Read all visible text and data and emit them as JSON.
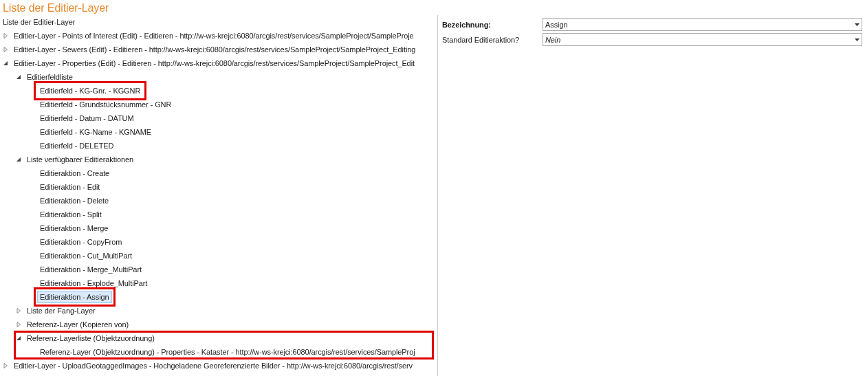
{
  "title": "Liste der Editier-Layer",
  "tree": {
    "label": "Liste der Editier-Layer",
    "nodes": [
      {
        "kind": "branch",
        "label": "Editier-Layer - Points of Interest (Edit) - Editieren - http://w-ws-krejci:6080/arcgis/rest/services/SampleProject/SampleProje",
        "expanded": false,
        "selected": false,
        "highlighted": false
      },
      {
        "kind": "branch",
        "label": "Editier-Layer - Sewers (Edit) - Editieren - http://w-ws-krejci:6080/arcgis/rest/services/SampleProject/SampleProject_Editing",
        "expanded": false,
        "selected": false,
        "highlighted": false
      },
      {
        "kind": "branch",
        "label": "Editier-Layer - Properties (Edit) - Editieren - http://w-ws-krejci:6080/arcgis/rest/services/SampleProject/SampleProject_Edit",
        "expanded": true,
        "selected": false,
        "highlighted": false,
        "children": [
          {
            "kind": "branch",
            "label": "Editierfeldliste",
            "expanded": true,
            "selected": false,
            "highlighted": false,
            "children": [
              {
                "kind": "leaf",
                "label": "Editierfeld - KG-Gnr. - KGGNR",
                "selected": false,
                "highlighted": true
              },
              {
                "kind": "leaf",
                "label": "Editierfeld - Grundstücksnummer - GNR",
                "selected": false,
                "highlighted": false
              },
              {
                "kind": "leaf",
                "label": "Editierfeld - Datum - DATUM",
                "selected": false,
                "highlighted": false
              },
              {
                "kind": "leaf",
                "label": "Editierfeld - KG-Name - KGNAME",
                "selected": false,
                "highlighted": false
              },
              {
                "kind": "leaf",
                "label": "Editierfeld - DELETED",
                "selected": false,
                "highlighted": false
              }
            ]
          },
          {
            "kind": "branch",
            "label": "Liste verfügbarer Editieraktionen",
            "expanded": true,
            "selected": false,
            "highlighted": false,
            "children": [
              {
                "kind": "leaf",
                "label": "Editieraktion - Create",
                "selected": false,
                "highlighted": false
              },
              {
                "kind": "leaf",
                "label": "Editieraktion - Edit",
                "selected": false,
                "highlighted": false
              },
              {
                "kind": "leaf",
                "label": "Editieraktion - Delete",
                "selected": false,
                "highlighted": false
              },
              {
                "kind": "leaf",
                "label": "Editieraktion - Split",
                "selected": false,
                "highlighted": false
              },
              {
                "kind": "leaf",
                "label": "Editieraktion - Merge",
                "selected": false,
                "highlighted": false
              },
              {
                "kind": "leaf",
                "label": "Editieraktion - CopyFrom",
                "selected": false,
                "highlighted": false
              },
              {
                "kind": "leaf",
                "label": "Editieraktion - Cut_MultiPart",
                "selected": false,
                "highlighted": false
              },
              {
                "kind": "leaf",
                "label": "Editieraktion - Merge_MultiPart",
                "selected": false,
                "highlighted": false
              },
              {
                "kind": "leaf",
                "label": "Editieraktion - Explode_MultiPart",
                "selected": false,
                "highlighted": false
              },
              {
                "kind": "leaf",
                "label": "Editieraktion - Assign",
                "selected": true,
                "highlighted": true
              }
            ]
          },
          {
            "kind": "branch",
            "label": "Liste der Fang-Layer",
            "expanded": false,
            "selected": false,
            "highlighted": false
          },
          {
            "kind": "branch",
            "label": "Referenz-Layer (Kopieren von)",
            "expanded": false,
            "selected": false,
            "highlighted": false
          },
          {
            "kind": "branch",
            "label": "Referenz-Layerliste (Objektzuordnung)",
            "expanded": true,
            "selected": false,
            "highlighted": true,
            "children": [
              {
                "kind": "leaf",
                "label": "Referenz-Layer (Objektzuordnung) - Properties - Kataster - http://w-ws-krejci:6080/arcgis/rest/services/SampleProj",
                "selected": false,
                "highlighted": false
              }
            ]
          }
        ]
      },
      {
        "kind": "branch",
        "label": "Editier-Layer - UploadGeotaggedImages - Hochgeladene Georeferenzierte Bilder - http://w-ws-krejci:6080/arcgis/rest/serv",
        "expanded": false,
        "selected": false,
        "highlighted": false
      }
    ]
  },
  "properties": [
    {
      "label": "Bezeichnung:",
      "bold": true,
      "value": "Assign",
      "is_default": false
    },
    {
      "label": "Standard Editieraktion?",
      "bold": false,
      "value": "Nein",
      "is_default": true
    }
  ]
}
